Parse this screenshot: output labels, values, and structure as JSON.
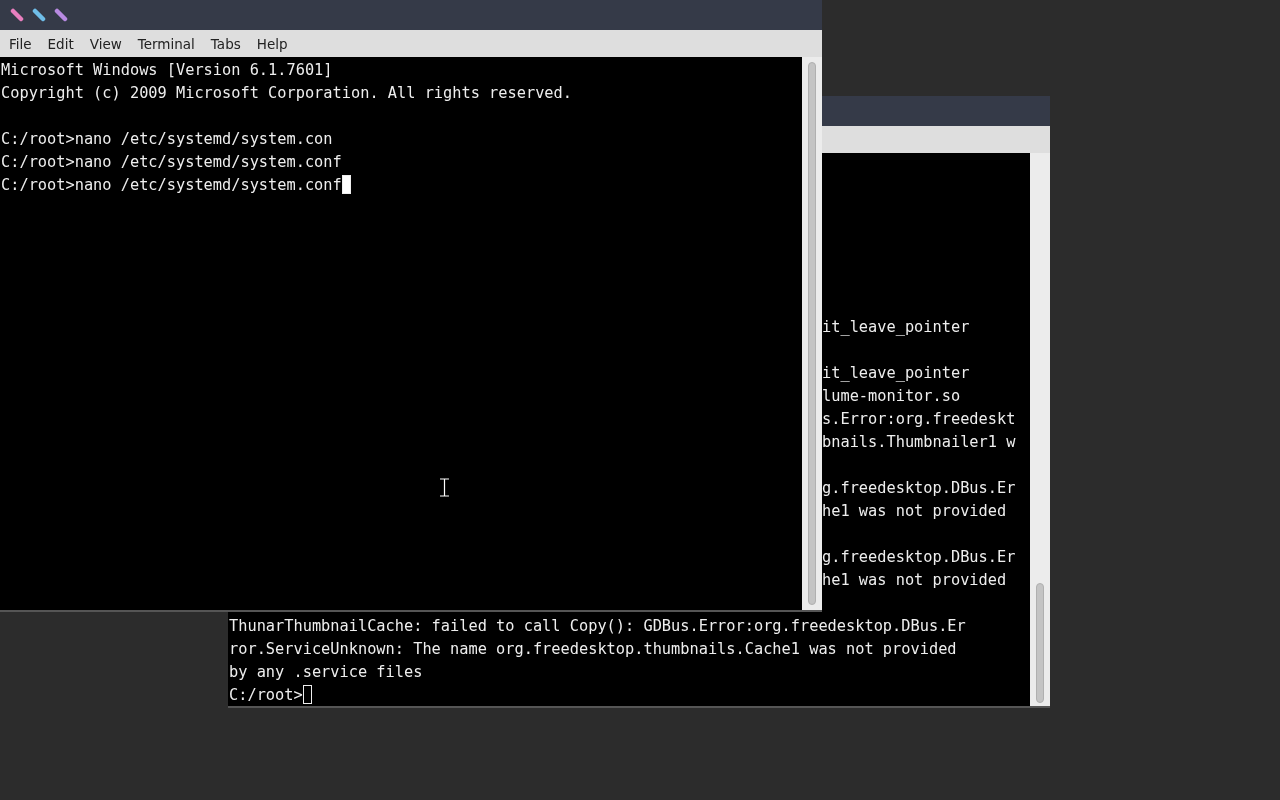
{
  "back_terminal": {
    "focused": false,
    "lines": [
      {
        "kind": "blank"
      },
      {
        "kind": "blank"
      },
      {
        "kind": "blank"
      },
      {
        "kind": "blank"
      },
      {
        "kind": "blank"
      },
      {
        "kind": "blank"
      },
      {
        "kind": "blank"
      },
      {
        "kind": "fragment",
        "text": "it_leave_pointer"
      },
      {
        "kind": "blank"
      },
      {
        "kind": "fragment",
        "text": "it_leave_pointer"
      },
      {
        "kind": "fragment",
        "text": "lume-monitor.so"
      },
      {
        "kind": "fragment",
        "text": "s.Error:org.freedeskt"
      },
      {
        "kind": "fragment",
        "text": "bnails.Thumbnailer1 w"
      },
      {
        "kind": "blank"
      },
      {
        "kind": "fragment",
        "text": "g.freedesktop.DBus.Er"
      },
      {
        "kind": "fragment",
        "text": "he1 was not provided"
      },
      {
        "kind": "blank"
      },
      {
        "kind": "fragment",
        "text": "g.freedesktop.DBus.Er"
      },
      {
        "kind": "fragment",
        "text": "he1 was not provided"
      },
      {
        "kind": "blank"
      },
      {
        "kind": "text",
        "text": "ThunarThumbnailCache: failed to call Copy(): GDBus.Error:org.freedesktop.DBus.Er"
      },
      {
        "kind": "text",
        "text": "ror.ServiceUnknown: The name org.freedesktop.thumbnails.Cache1 was not provided"
      },
      {
        "kind": "text",
        "text": "by any .service files"
      },
      {
        "kind": "text",
        "text": "C:/root>"
      }
    ]
  },
  "front_terminal": {
    "focused": true,
    "title_buttons": [
      {
        "color": "#e87fbf"
      },
      {
        "color": "#6fbde8"
      },
      {
        "color": "#b88ae2"
      }
    ],
    "menu": [
      "File",
      "Edit",
      "View",
      "Terminal",
      "Tabs",
      "Help"
    ],
    "lines": [
      {
        "kind": "text",
        "text": "Microsoft Windows [Version 6.1.7601]"
      },
      {
        "kind": "text",
        "text": "Copyright (c) 2009 Microsoft Corporation. All rights reserved."
      },
      {
        "kind": "blank"
      },
      {
        "kind": "text",
        "text": "C:/root>nano /etc/systemd/system.con"
      },
      {
        "kind": "text",
        "text": "C:/root>nano /etc/systemd/system.conf"
      },
      {
        "kind": "text",
        "text": "C:/root>nano /etc/systemd/system.conf"
      }
    ]
  }
}
